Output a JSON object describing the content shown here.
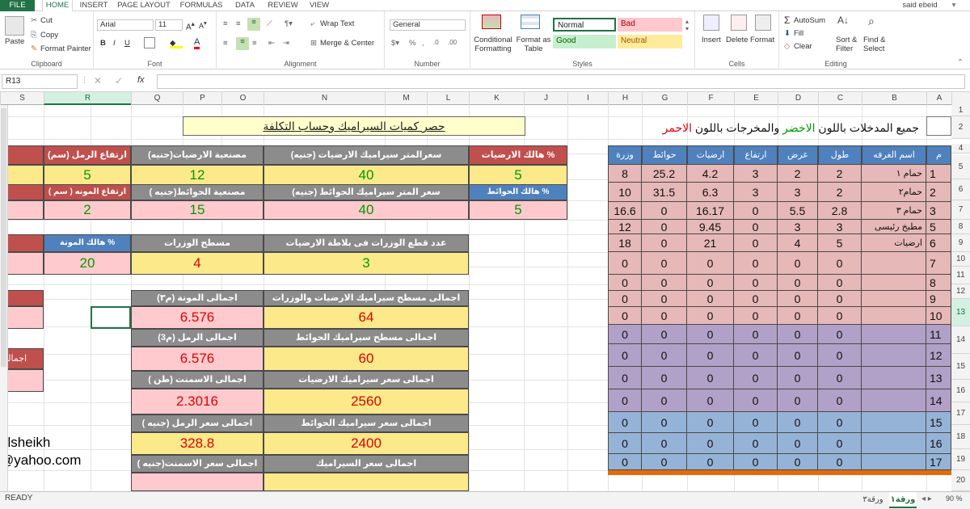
{
  "ribbon_tabs": [
    "FILE",
    "HOME",
    "INSERT",
    "PAGE LAYOUT",
    "FORMULAS",
    "DATA",
    "REVIEW",
    "VIEW"
  ],
  "user": "said ebeid",
  "clipboard": {
    "paste": "Paste",
    "cut": "Cut",
    "copy": "Copy",
    "format_painter": "Format Painter",
    "label": "Clipboard"
  },
  "font": {
    "name": "Arial",
    "size": "11",
    "label": "Font"
  },
  "alignment": {
    "wrap": "Wrap Text",
    "merge": "Merge & Center",
    "label": "Alignment"
  },
  "number": {
    "format": "General",
    "label": "Number"
  },
  "styles": {
    "conditional": "Conditional Formatting",
    "format_table": "Format as Table",
    "normal": "Normal",
    "bad": "Bad",
    "good": "Good",
    "neutral": "Neutral",
    "label": "Styles"
  },
  "cells": {
    "insert": "Insert",
    "delete": "Delete",
    "format": "Format",
    "label": "Cells"
  },
  "editing": {
    "autosum": "AutoSum",
    "fill": "Fill",
    "clear": "Clear",
    "sort": "Sort & Filter",
    "find": "Find & Select",
    "label": "Editing"
  },
  "formula_bar": {
    "name_box": "R13",
    "fx": "fx",
    "value": ""
  },
  "columns": [
    "S",
    "R",
    "Q",
    "P",
    "O",
    "N",
    "M",
    "L",
    "K",
    "J",
    "I",
    "H",
    "G",
    "F",
    "E",
    "D",
    "C",
    "B",
    "A"
  ],
  "rows": [
    "1",
    "2",
    "3",
    "4",
    "5",
    "6",
    "7",
    "8",
    "9",
    "10",
    "11",
    "12",
    "13",
    "14",
    "15",
    "16",
    "17",
    "18",
    "19",
    "20"
  ],
  "title_left": "حصر كميات السيراميك وحساب التكلفة",
  "title_right": {
    "p1": "جميع المدخلات باللون ",
    "p2": "الاخضر",
    "p3": " والمخرجات باللون ",
    "p4": "الاحمر"
  },
  "inputs": {
    "h_sand_height": "ارتفاع الرمل (سم)",
    "h_floor_labor": "مصنعية الارضيات(جنيه)",
    "h_floor_price": "سعرالمتر  سيراميك الارضيات (جنيه)",
    "h_floor_waste": "هالك الارضيات  %",
    "v_sand_height": "5",
    "v_floor_labor": "12",
    "v_floor_price": "40",
    "v_floor_waste": "5",
    "v_cut5": "5",
    "h_mortar_height": "ارتفاع المونه  ( سم )",
    "h_wall_labor": "مصنعية الحوائط(جنيه )",
    "h_wall_price": "سعر المتر سيراميك الحوائط (جنيه)",
    "h_wall_waste": "هالك الحوائط  %",
    "v_mortar_height": "2",
    "v_wall_labor": "15",
    "v_wall_price": "40",
    "v_wall_waste": "5",
    "v_cut6": "5",
    "h_mortar_waste": "هالك المونة %",
    "h_skirting_area": "مسطح الوزرات",
    "h_skirting_count": "عدد قطع الوزرات فى بلاطة الارضيات",
    "v_mortar_waste": "20",
    "v_skirting_area": "4",
    "v_skirting_count": "3",
    "cut_m": "م"
  },
  "outputs": {
    "h_mortar_total": "اجمالى المونة (م٣)",
    "h_floor_skirt_area": "اجمالى مسطح سيراميك الارضيات والوزرات",
    "v_mortar_total": "6.576",
    "v_floor_skirt_area": "64",
    "h_sand_total": "اجمالى الرمل (م3)",
    "h_wall_area": "اجمالى مسطح سيراميك الحوائط",
    "v_sand_total": "6.576",
    "v_wall_area": "60",
    "h_cement_total": "اجمالى الاسمنت (طن )",
    "h_floor_cost": "اجمالى سعر سيراميك الارضيات",
    "v_cement_total": "2.3016",
    "v_floor_cost": "2560",
    "h_sand_cost": "اجمالى سعر الرمل (جنيه )",
    "h_wall_cost": "اجمالى سعر سيراميك الحوائط",
    "v_sand_cost": "328.8",
    "v_wall_cost": "2400",
    "h_cement_cost": "اجمالى سعر الاسمنت(جنيه )",
    "h_ceramic_cost": "اجمالى سعر السيراميك",
    "cut_total": "اجمالى",
    "email1": "elsheikh",
    "email2": "@yahoo.com"
  },
  "rooms_table": {
    "headers": [
      "وزرة",
      "حوائط",
      "ارضيات",
      "ارتفاع",
      "عرض",
      "طول",
      "اسم الغرفه",
      "م"
    ],
    "rows": [
      [
        "8",
        "25.2",
        "4.2",
        "3",
        "2",
        "2",
        "حمام ١",
        "1"
      ],
      [
        "10",
        "31.5",
        "6.3",
        "3",
        "3",
        "2",
        "حمام٢",
        "2"
      ],
      [
        "16.6",
        "0",
        "16.17",
        "0",
        "5.5",
        "2.8",
        "حمام ٣",
        "3"
      ],
      [
        "12",
        "0",
        "9.45",
        "0",
        "3",
        "3",
        "مطبخ رئيسى",
        "5"
      ],
      [
        "18",
        "0",
        "21",
        "0",
        "4",
        "5",
        "ارضيات",
        "6"
      ],
      [
        "0",
        "0",
        "0",
        "0",
        "0",
        "0",
        "",
        "7"
      ],
      [
        "0",
        "0",
        "0",
        "0",
        "0",
        "0",
        "",
        "8"
      ],
      [
        "0",
        "0",
        "0",
        "0",
        "0",
        "0",
        "",
        "9"
      ],
      [
        "0",
        "0",
        "0",
        "0",
        "0",
        "0",
        "",
        "10"
      ],
      [
        "0",
        "0",
        "0",
        "0",
        "0",
        "0",
        "",
        "11"
      ],
      [
        "0",
        "0",
        "0",
        "0",
        "0",
        "0",
        "",
        "12"
      ],
      [
        "0",
        "0",
        "0",
        "0",
        "0",
        "0",
        "",
        "13"
      ],
      [
        "0",
        "0",
        "0",
        "0",
        "0",
        "0",
        "",
        "14"
      ],
      [
        "0",
        "0",
        "0",
        "0",
        "0",
        "0",
        "",
        "15"
      ],
      [
        "0",
        "0",
        "0",
        "0",
        "0",
        "0",
        "",
        "16"
      ],
      [
        "0",
        "0",
        "0",
        "0",
        "0",
        "0",
        "",
        "17"
      ]
    ]
  },
  "sheet_tabs": [
    "ورقة١",
    "ورقة٣"
  ],
  "status": {
    "ready": "READY",
    "zoom": "90 %"
  }
}
